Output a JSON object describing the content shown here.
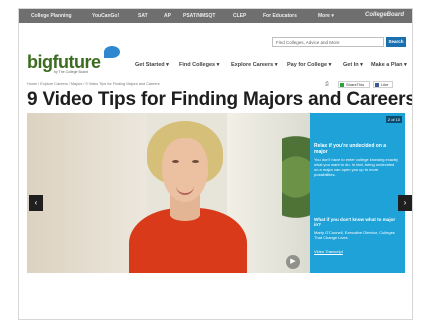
{
  "topnav": {
    "items": [
      "College Planning",
      "YouCanGo!",
      "SAT",
      "AP",
      "PSAT/NMSQT",
      "CLEP",
      "For Educators",
      "More ▾"
    ],
    "logo": "CollegeBoard"
  },
  "header": {
    "brand": "bigfuture",
    "brand_sub": "by The College Board",
    "search_placeholder": "Find Colleges, Advice and More",
    "search_button": "Search",
    "menu": [
      "Get Started ▾",
      "Find Colleges ▾",
      "Explore Careers ▾",
      "Pay for College ▾",
      "Get In ▾",
      "Make a Plan ▾"
    ]
  },
  "breadcrumb": "Home / Explore Careers / Majors / 9 Video Tips for Finding Majors and Careers",
  "utility": {
    "print_icon": "print-icon",
    "share_label": "ShareThis",
    "like_label": "Like"
  },
  "page_title": "9 Video Tips for Finding Majors and Careers",
  "hero": {
    "counter": "2 of 10",
    "heading": "Relax if you're undecided on a major",
    "body": "You don't have to enter college knowing exactly what you want to do. In fact, being undecided on a major can open you up to more possibilities.",
    "question": "What if you don't know what to major in?",
    "attribution": "Marty O'Connell, Executive Director, Colleges That Change Lives",
    "transcript": "Video Transcript",
    "prev_icon": "chevron-left-icon",
    "next_icon": "chevron-right-icon",
    "play_icon": "play-icon",
    "colors": {
      "panel": "#1ea2d8",
      "arrow": "#1f1f1f"
    }
  }
}
